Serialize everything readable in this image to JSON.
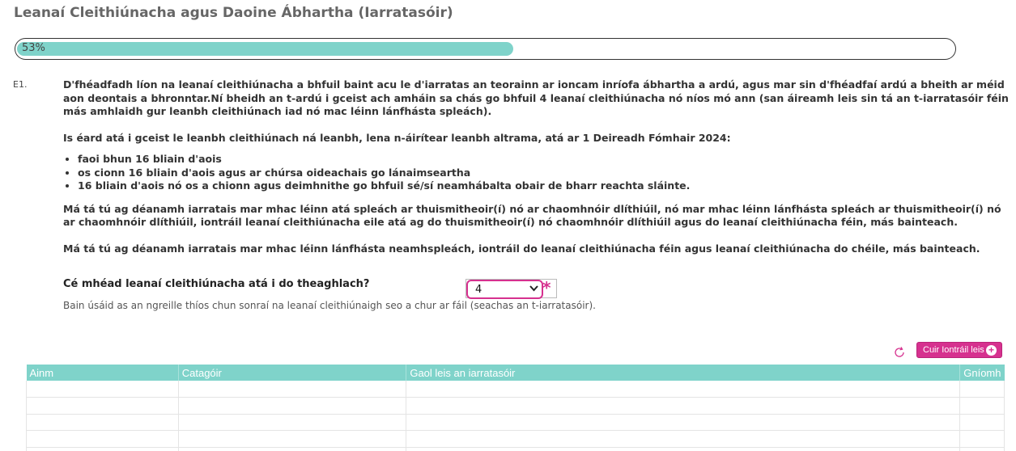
{
  "page": {
    "title": "Leanaí Cleithiúnacha agus Daoine Ábhartha (Iarratasóir)"
  },
  "progress": {
    "label": "53%",
    "value": 0.53
  },
  "question": {
    "number": "E1.",
    "para1": "D'fhéadfadh líon na leanaí cleithiúnacha a bhfuil baint acu le d'iarratas an teorainn ar ioncam inríofa ábhartha a ardú, agus mar sin d'fhéadfaí ardú a bheith ar méid aon deontais a bhronntar.Ní bheidh an t-ardú i gceist ach amháin sa chás go bhfuil 4 leanaí cleithiúnacha nó níos mó ann (san áireamh leis sin tá an t-iarratasóir féin más amhlaidh gur leanbh cleithiúnach iad nó mac léinn lánfhásta spleách).",
    "para2": "Is éard atá i gceist le leanbh cleithiúnach ná leanbh, lena n-áirítear leanbh altrama, atá ar 1 Deireadh Fómhair 2024:",
    "bullets": [
      "faoi bhun 16 bliain d'aois",
      "os cionn 16 bliain d'aois agus ar chúrsa oideachais go lánaimseartha",
      "16 bliain d'aois nó os a chionn agus deimhnithe go bhfuil sé/sí neamhábalta obair de bharr reachta sláinte."
    ],
    "para3": "Má tá tú ag déanamh iarratais mar mhac léinn atá spleách ar thuismitheoir(í) nó ar chaomhnóir dlíthiúil, nó mar mhac léinn lánfhásta spleách ar thuismitheoir(í) nó ar chaomhnóir dlíthiúil, iontráil leanaí cleithiúnacha eile atá ag do thuismitheoir(í) nó chaomhnóir dlíthiúil agus do leanaí cleithiúnacha féin, más bainteach.",
    "para4": "Má tá tú ag déanamh iarratais mar mhac léinn lánfhásta neamhspleách, iontráil do leanaí cleithiúnacha féin agus leanaí cleithiúnacha do chéile, más bainteach."
  },
  "field": {
    "label": "Cé mhéad leanaí cleithiúnacha atá i do theaghlach?",
    "selected_value": "4",
    "required_mark": "*",
    "help": "Bain úsáid as an ngreille thíos chun sonraí na leanaí cleithiúnaigh seo a chur ar fáil (seachas an t-iarratasóir)."
  },
  "grid": {
    "add_button_label": "Cuir Iontráil leis",
    "columns": [
      "Ainm",
      "Catagóir",
      "Gaol leis an iarratasóir",
      "Gníomh"
    ],
    "rows": [
      [
        "",
        "",
        "",
        ""
      ],
      [
        "",
        "",
        "",
        ""
      ],
      [
        "",
        "",
        "",
        ""
      ],
      [
        "",
        "",
        "",
        ""
      ],
      [
        "",
        "",
        "",
        ""
      ]
    ]
  },
  "icons": {
    "refresh": "refresh-icon",
    "add": "plus-circle-icon",
    "chevron": "chevron-down-icon"
  },
  "colors": {
    "accent": "#7fd3ca",
    "brand": "#d6318f"
  }
}
